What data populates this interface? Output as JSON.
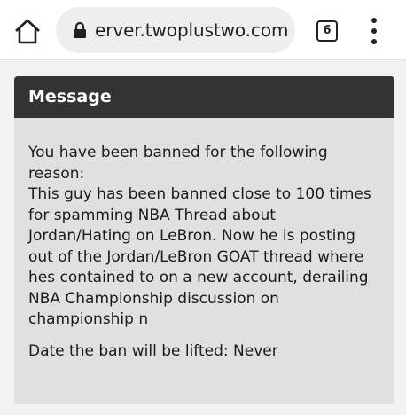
{
  "browser": {
    "url": "erver.twoplustwo.com",
    "tab_count": "6"
  },
  "message": {
    "title": "Message",
    "reason_intro": "You have been banned for the following reason:",
    "reason_text": "This guy has been banned close to 100 times for spamming NBA Thread about Jordan/Hating on LeBron. Now he is posting out of the Jordan/LeBron GOAT thread where hes contained to on a new account, derailing NBA Championship discussion on championship n",
    "ban_lift_label": "Date the ban will be lifted:",
    "ban_lift_value": "Never"
  },
  "icons": {
    "home": "home-icon",
    "lock": "lock-icon",
    "tabs": "tab-switcher-icon",
    "menu": "more-vert-icon"
  },
  "colors": {
    "header_bg": "#333333",
    "message_bg": "#e0e0e0",
    "page_bg": "#f2f2f2"
  }
}
